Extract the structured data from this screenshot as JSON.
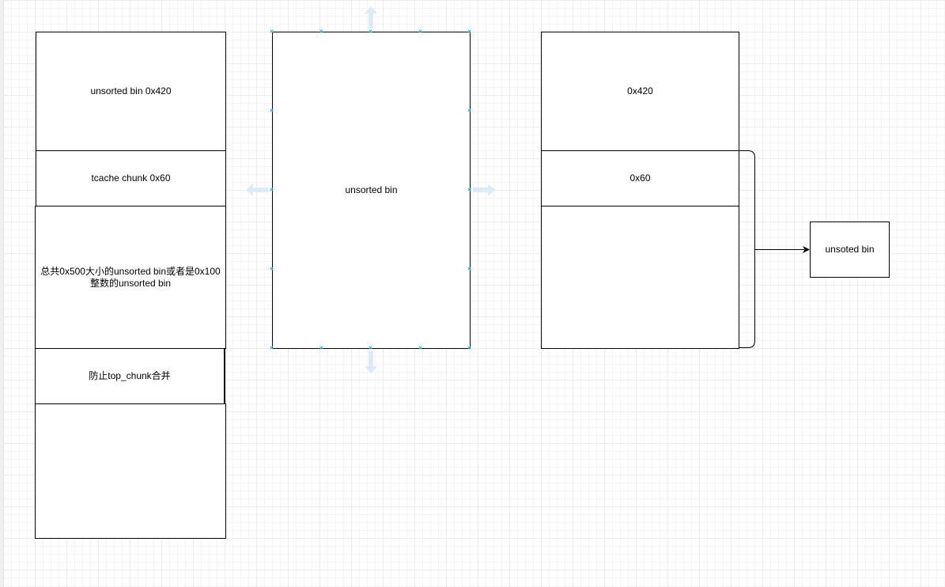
{
  "diagram": {
    "left_stack": {
      "blocks": [
        {
          "label": "unsorted bin 0x420"
        },
        {
          "label": "tcache  chunk 0x60"
        },
        {
          "label": "总共0x500大小的unsorted bin或者是0x100整数的unsorted bin"
        },
        {
          "label": "防止top_chunk合并"
        },
        {
          "label": ""
        }
      ]
    },
    "middle_box": {
      "label": "unsorted bin",
      "selected": true
    },
    "right_stack": {
      "blocks": [
        {
          "label": "0x420"
        },
        {
          "label": "0x60"
        },
        {
          "label": ""
        }
      ]
    },
    "target_box": {
      "label": "unsoted bin"
    },
    "colors": {
      "selection_handle": "#29b6f2",
      "guide_arrow": "#dcebf7",
      "grid_major": "#ececec",
      "grid_minor": "#f5f5f5",
      "stroke": "#000000"
    }
  }
}
